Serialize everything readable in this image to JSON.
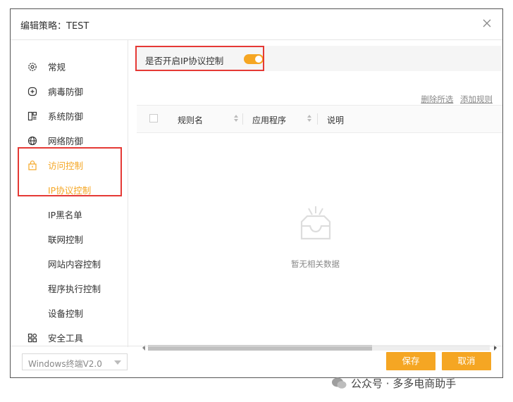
{
  "dialog": {
    "title": "编辑策略：TEST",
    "close_icon": "close-icon"
  },
  "sidebar": {
    "items": [
      {
        "key": "general",
        "label": "常规",
        "icon": "gear-icon"
      },
      {
        "key": "virus",
        "label": "病毒防御",
        "icon": "plus-circle-icon"
      },
      {
        "key": "system",
        "label": "系统防御",
        "icon": "system-icon"
      },
      {
        "key": "network",
        "label": "网络防御",
        "icon": "globe-icon"
      },
      {
        "key": "access",
        "label": "访问控制",
        "icon": "lock-icon",
        "active": true
      },
      {
        "key": "ip",
        "label": "IP协议控制",
        "sub": true,
        "active": true
      },
      {
        "key": "ip-blacklist",
        "label": "IP黑名单",
        "sub": true
      },
      {
        "key": "internet",
        "label": "联网控制",
        "sub": true
      },
      {
        "key": "website",
        "label": "网站内容控制",
        "sub": true
      },
      {
        "key": "program",
        "label": "程序执行控制",
        "sub": true
      },
      {
        "key": "device",
        "label": "设备控制",
        "sub": true
      },
      {
        "key": "tools",
        "label": "安全工具",
        "icon": "grid-icon"
      }
    ]
  },
  "content": {
    "toggle_label": "是否开启IP协议控制",
    "toggle_on": true,
    "delete_selected": "删除所选",
    "add_rule": "添加规则",
    "columns": [
      "规则名",
      "应用程序",
      "说明"
    ],
    "empty_text": "暂无相关数据"
  },
  "footer": {
    "version": "Windows终端V2.0",
    "save": "保存",
    "cancel": "取消"
  },
  "watermark": {
    "text": "公众号 · 多多电商助手"
  },
  "colors": {
    "accent": "#f5a623",
    "highlight_box": "#e53935"
  }
}
